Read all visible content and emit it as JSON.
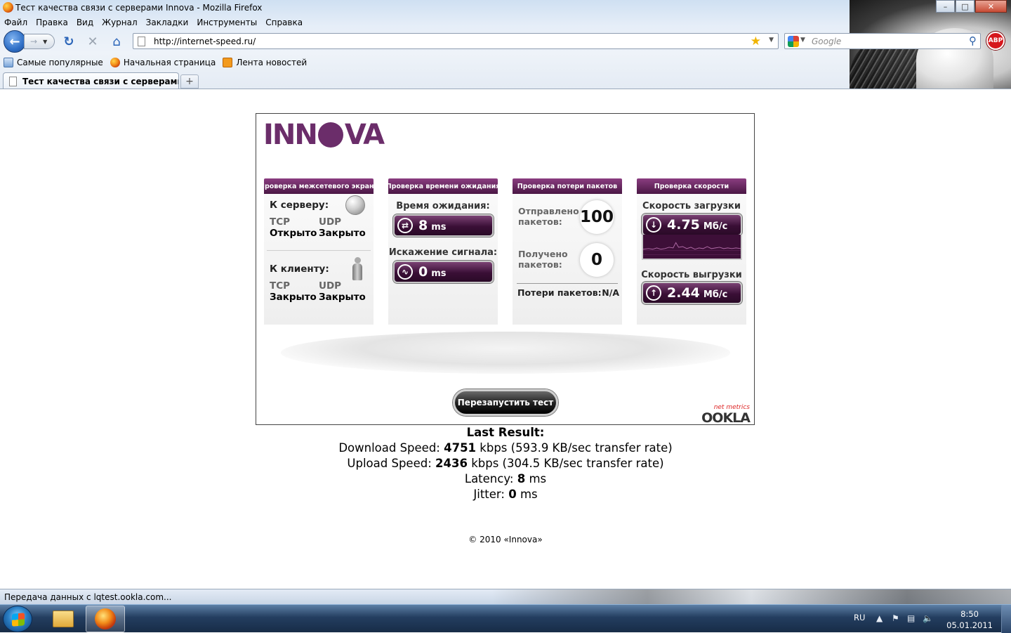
{
  "window": {
    "title": "Тест качества связи с серверами Innova - Mozilla Firefox",
    "controls": [
      "–",
      "□",
      "✕"
    ]
  },
  "menu": [
    "Файл",
    "Правка",
    "Вид",
    "Журнал",
    "Закладки",
    "Инструменты",
    "Справка"
  ],
  "nav": {
    "url": "http://internet-speed.ru/",
    "search_placeholder": "Google",
    "abp": "ABP"
  },
  "bookmarks": [
    "Самые популярные",
    "Начальная страница",
    "Лента новостей"
  ],
  "tab": {
    "title": "Тест качества связи с серверами In...",
    "new_tab": "+"
  },
  "speedtest": {
    "logo": "INNOVA",
    "firewall": {
      "header": "Проверка межсетевого экрана",
      "server_title": "К серверу:",
      "server": {
        "tcp_label": "TCP",
        "tcp": "Открыто",
        "udp_label": "UDP",
        "udp": "Закрыто"
      },
      "client_title": "К клиенту:",
      "client": {
        "tcp_label": "TCP",
        "tcp": "Закрыто",
        "udp_label": "UDP",
        "udp": "Закрыто"
      }
    },
    "latency": {
      "header": "Проверка времени ожидания",
      "ping_label": "Время ожидания:",
      "ping_value": "8",
      "ping_unit": "ms",
      "jitter_label": "Искажение сигнала:",
      "jitter_value": "0",
      "jitter_unit": "ms"
    },
    "packet_loss": {
      "header": "Проверка потери пакетов",
      "sent_label": "Отправлено пакетов:",
      "sent_value": "100",
      "received_label": "Получено пакетов:",
      "received_value": "0",
      "loss_label": "Потери пакетов:",
      "loss_value": "N/A"
    },
    "speed": {
      "header": "Проверка скорости",
      "download_label": "Скорость загрузки",
      "download_value": "4.75",
      "download_unit": "Мб/с",
      "upload_label": "Скорость выгрузки",
      "upload_value": "2.44",
      "upload_unit": "Мб/с"
    },
    "restart_button": "Перезапустить тест",
    "ookla_small": "net metrics",
    "ookla": "OOKLA"
  },
  "results": {
    "heading": "Last Result:",
    "download_label": "Download Speed:",
    "download_value": "4751",
    "download_suffix": "kbps (593.9 KB/sec transfer rate)",
    "upload_label": "Upload Speed:",
    "upload_value": "2436",
    "upload_suffix": "kbps (304.5 KB/sec transfer rate)",
    "latency_label": "Latency:",
    "latency_value": "8",
    "latency_unit": "ms",
    "jitter_label": "Jitter:",
    "jitter_value": "0",
    "jitter_unit": "ms"
  },
  "copyright": "© 2010 «Innova»",
  "status": "Передача данных с lqtest.ookla.com...",
  "tray": {
    "lang": "RU",
    "time": "8:50",
    "date": "05.01.2011"
  }
}
